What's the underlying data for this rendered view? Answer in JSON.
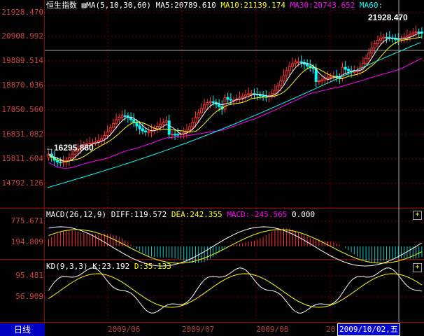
{
  "header": {
    "index_name": "恒生指数",
    "ma_spec": "MA(5,10,30,60)",
    "ma5": "MA5:20789.610",
    "ma10": "MA10:21139.174",
    "ma30": "MA30:20743.652",
    "ma60": "MA60:"
  },
  "price_axis": [
    "21928.470",
    "20908.992",
    "19889.514",
    "18870.036",
    "17850.560",
    "16831.082",
    "15811.604",
    "14792.126"
  ],
  "annotations": {
    "high": "21928.470",
    "low": "16295.860"
  },
  "macd": {
    "spec": "MACD(26,12,9)",
    "diff": "DIFF:119.572",
    "dea": "DEA:242.355",
    "macd": "MACD:-245.565",
    "zero": "0.000",
    "axis": [
      "775.671",
      "194.809"
    ]
  },
  "kd": {
    "spec": "KD(9,3,3)",
    "k": "K:23.192",
    "d": "D:35.133",
    "axis": [
      "95.481",
      "56.909"
    ]
  },
  "footer": {
    "period_tab": "日线",
    "months": [
      "2009/06",
      "2009/07",
      "2009/08",
      "20"
    ],
    "cursor_date": "2009/10/02,五"
  },
  "buttons": {
    "plus": "+"
  },
  "colors": {
    "up": "#ff3333",
    "down": "#00ffff",
    "ma5": "#ffffff",
    "ma10": "#ffff00",
    "ma30": "#ff00ff",
    "ma60": "#00ffff"
  }
}
